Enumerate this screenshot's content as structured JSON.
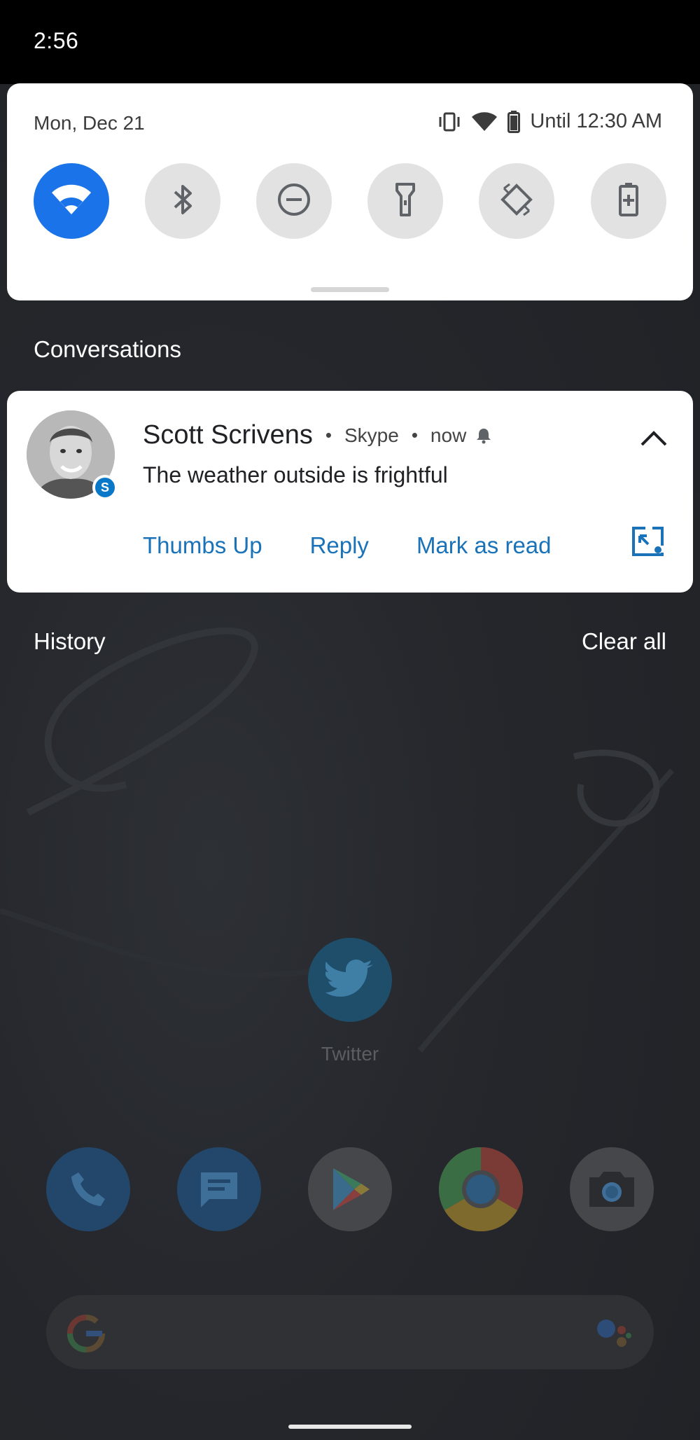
{
  "status_bar": {
    "time": "2:56"
  },
  "quick_settings": {
    "date": "Mon, Dec 21",
    "battery_text": "Until 12:30 AM",
    "tiles": [
      {
        "name": "wifi",
        "icon": "wifi-icon",
        "active": true
      },
      {
        "name": "bluetooth",
        "icon": "bluetooth-icon",
        "active": false
      },
      {
        "name": "do-not-disturb",
        "icon": "do-not-disturb-icon",
        "active": false
      },
      {
        "name": "flashlight",
        "icon": "flashlight-icon",
        "active": false
      },
      {
        "name": "auto-rotate",
        "icon": "auto-rotate-icon",
        "active": false
      },
      {
        "name": "battery-saver",
        "icon": "battery-saver-icon",
        "active": false
      }
    ],
    "accent_color": "#1a73e8"
  },
  "conversations": {
    "heading": "Conversations",
    "notification": {
      "sender": "Scott Scrivens",
      "app": "Skype",
      "time": "now",
      "badge_letter": "S",
      "message": "The weather outside is frightful",
      "actions": [
        "Thumbs Up",
        "Reply",
        "Mark as read"
      ]
    }
  },
  "history": {
    "heading": "History",
    "clear_all": "Clear all"
  },
  "home": {
    "twitter_label": "Twitter"
  }
}
